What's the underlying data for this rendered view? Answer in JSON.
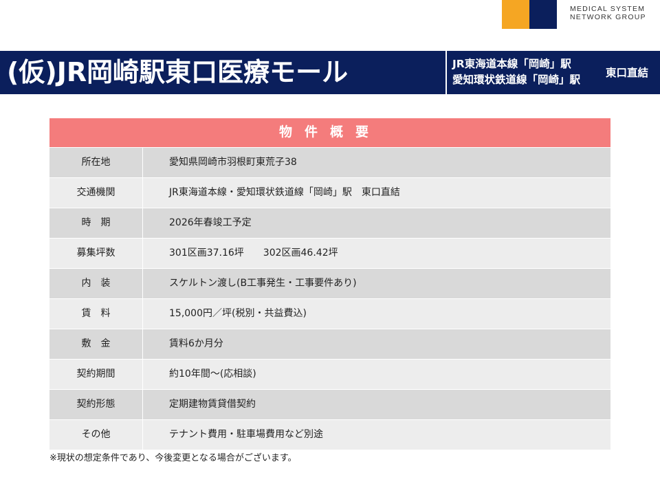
{
  "logo": {
    "line1": "MEDICAL SYSTEM",
    "line2": "NETWORK GROUP",
    "gold_color": "#F5A623",
    "navy_color": "#0B1F5C"
  },
  "header": {
    "title": "(仮)JR岡崎駅東口医療モール",
    "station_line1": "JR東海道本線「岡崎」駅",
    "station_line2": "愛知環状鉄道線「岡崎」駅",
    "exit": "東口直結",
    "band_color": "#0B1F5C"
  },
  "table": {
    "heading": "物件概要",
    "heading_color": "#F47C7C",
    "rows": [
      {
        "label": "所在地",
        "value": "愛知県岡崎市羽根町東荒子38"
      },
      {
        "label": "交通機関",
        "value": "JR東海道本線・愛知環状鉄道線「岡崎」駅　東口直結"
      },
      {
        "label": "時　期",
        "value": "2026年春竣工予定"
      },
      {
        "label": "募集坪数",
        "value": "301区画37.16坪　　302区画46.42坪"
      },
      {
        "label": "内　装",
        "value": "スケルトン渡し(B工事発生・工事要件あり)"
      },
      {
        "label": "賃　料",
        "value": "15,000円／坪(税別・共益費込)"
      },
      {
        "label": "敷　金",
        "value": "賃料6か月分"
      },
      {
        "label": "契約期間",
        "value": "約10年間～(応相談)"
      },
      {
        "label": "契約形態",
        "value": "定期建物賃貸借契約"
      },
      {
        "label": "その他",
        "value": "テナント費用・駐車場費用など別途"
      }
    ]
  },
  "footnote": "※現状の想定条件であり、今後変更となる場合がございます。"
}
